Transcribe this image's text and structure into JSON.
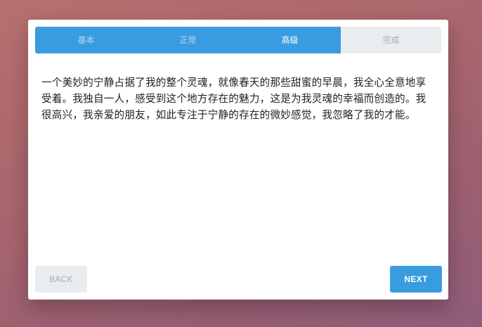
{
  "wizard": {
    "steps": [
      {
        "label": "基本",
        "state": "done"
      },
      {
        "label": "正常",
        "state": "done"
      },
      {
        "label": "高级",
        "state": "current"
      },
      {
        "label": "完成",
        "state": "pending"
      }
    ],
    "body_text": "一个美妙的宁静占据了我的整个灵魂，就像春天的那些甜蜜的早晨，我全心全意地享受着。我独自一人，感受到这个地方存在的魅力，这是为我灵魂的幸福而创造的。我很高兴，我亲爱的朋友，如此专注于宁静的存在的微妙感觉，我忽略了我的才能。",
    "back_label": "BACK",
    "next_label": "NEXT"
  },
  "colors": {
    "accent": "#3a9ce0",
    "inactive": "#e9edef"
  }
}
